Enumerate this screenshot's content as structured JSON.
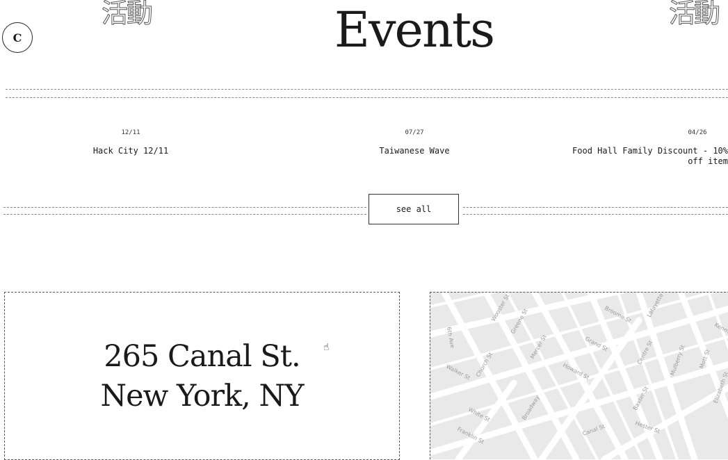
{
  "header": {
    "logo_icon": "circle-c-logo-icon",
    "logo_text": "C",
    "cjk_label": "活動",
    "title": "Events"
  },
  "events": [
    {
      "date": "12/11",
      "title": "Hack City 12/11"
    },
    {
      "date": "07/27",
      "title": "Taiwanese Wave"
    },
    {
      "date": "04/26",
      "title": "Food Hall Family Discount - 10% off item"
    }
  ],
  "see_all_label": "see all",
  "address": {
    "line1": "265 Canal St.",
    "line2": "New York, NY"
  },
  "map": {
    "streets": [
      "Broome St",
      "Lafayette",
      "Grand St",
      "Canal St",
      "Walker St",
      "Church St",
      "Broadway",
      "Centre St",
      "Mulberry St",
      "Mott St",
      "Howard St",
      "White St",
      "Franklin St",
      "Baxter St",
      "Hester St",
      "Greene St",
      "Mercer St",
      "Wooster St",
      "6th Ave",
      "Elizabeth St",
      "Kenmare"
    ]
  }
}
